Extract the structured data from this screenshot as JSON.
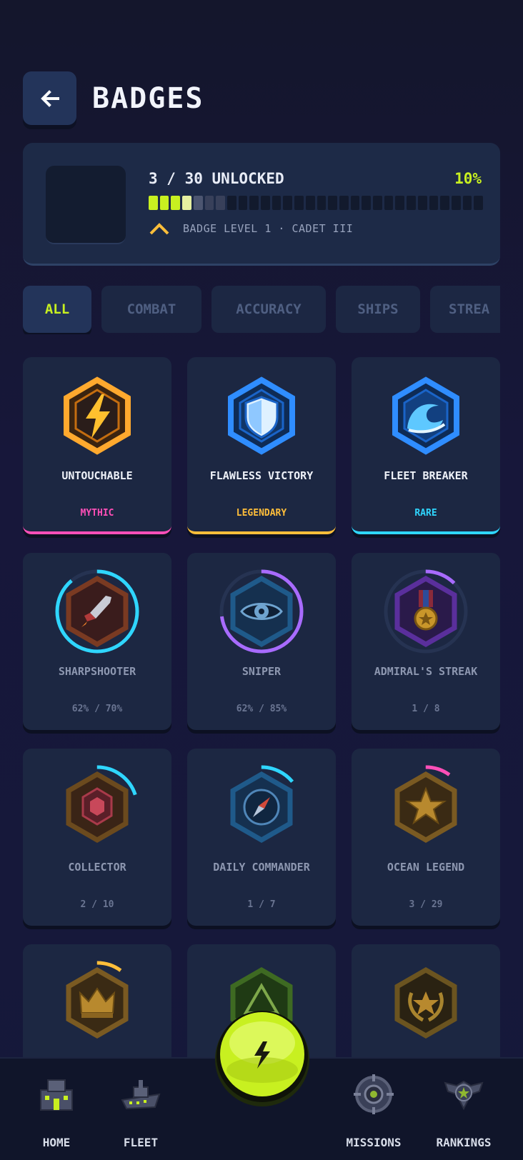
{
  "header": {
    "title": "BADGES",
    "back_icon": "arrow-left-icon"
  },
  "progress": {
    "unlocked_label": "3 / 30 UNLOCKED",
    "percent_label": "10%",
    "percent": 0.1,
    "segments_total": 30,
    "level_label": "BADGE LEVEL 1 · CADET III"
  },
  "tabs": [
    {
      "label": "ALL",
      "active": true
    },
    {
      "label": "COMBAT"
    },
    {
      "label": "ACCURACY"
    },
    {
      "label": "SHIPS"
    },
    {
      "label": "STREA"
    }
  ],
  "badges": [
    {
      "name": "UNTOUCHABLE",
      "sub": "MYTHIC",
      "icon": "lightning-icon",
      "rarity_color": "#ff4fb8"
    },
    {
      "name": "FLAWLESS VICTORY",
      "sub": "LEGENDARY",
      "icon": "shield-icon",
      "rarity_color": "#ffbe3a"
    },
    {
      "name": "FLEET BREAKER",
      "sub": "RARE",
      "icon": "wave-icon",
      "rarity_color": "#2fd6ff"
    },
    {
      "name": "SHARPSHOOTER",
      "sub": "62% / 70%",
      "icon": "rocket-icon",
      "progress": 0.89
    },
    {
      "name": "SNIPER",
      "sub": "62% / 85%",
      "icon": "eye-icon",
      "progress": 0.73
    },
    {
      "name": "ADMIRAL'S STREAK",
      "sub": "1 / 8",
      "icon": "medal-icon",
      "progress": 0.125
    },
    {
      "name": "COLLECTOR",
      "sub": "2 / 10",
      "icon": "gem-icon",
      "progress": 0.2
    },
    {
      "name": "DAILY COMMANDER",
      "sub": "1 / 7",
      "icon": "compass-icon",
      "progress": 0.14
    },
    {
      "name": "OCEAN LEGEND",
      "sub": "3 / 29",
      "icon": "star-icon",
      "progress": 0.1
    },
    {
      "name": "",
      "sub": "",
      "icon": "crown-icon",
      "progress": 0.1
    },
    {
      "name": "",
      "sub": "",
      "icon": "triangle-icon",
      "progress": 0.0
    },
    {
      "name": "",
      "sub": "",
      "icon": "laurel-star-icon",
      "progress": 0.0
    }
  ],
  "nav": [
    {
      "label": "HOME",
      "icon": "base-icon"
    },
    {
      "label": "FLEET",
      "icon": "ship-icon"
    },
    {
      "label": "MISSIONS",
      "icon": "target-icon"
    },
    {
      "label": "RANKINGS",
      "icon": "rank-icon"
    }
  ],
  "fab": {
    "icon": "lightning-icon"
  },
  "colors": {
    "accent": "#c8f020",
    "mythic": "#ff4fb8",
    "legendary": "#ffbe3a",
    "rare": "#2fd6ff",
    "epic": "#a86bff"
  }
}
